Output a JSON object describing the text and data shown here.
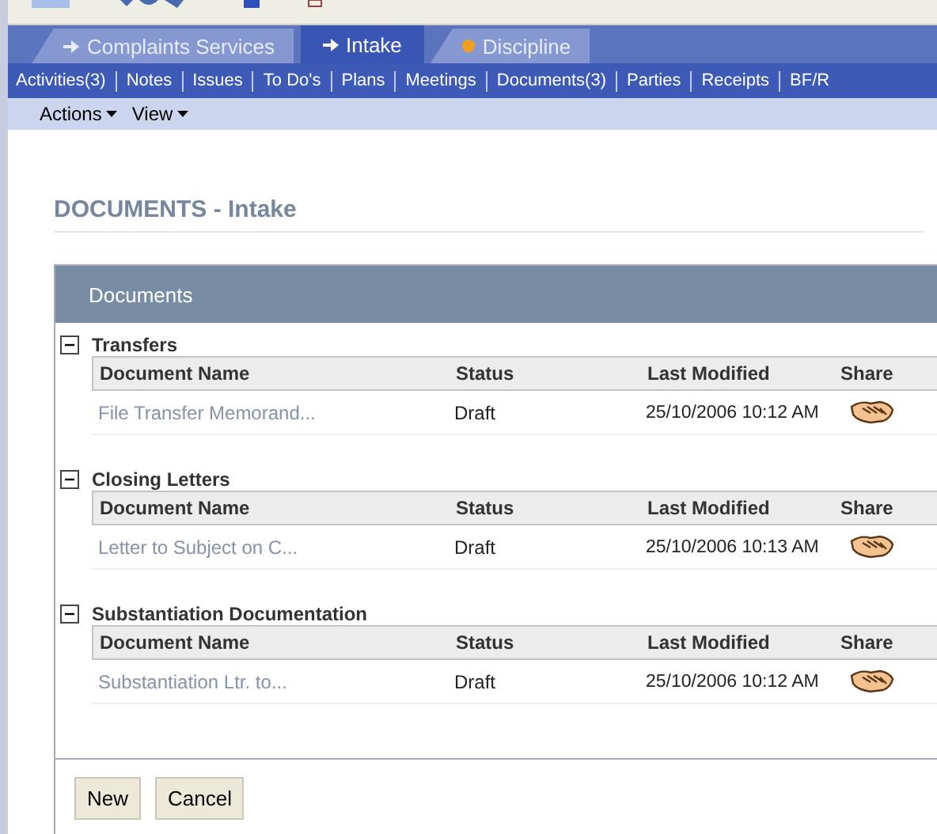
{
  "tabs": [
    {
      "label": "Complaints Services",
      "kind": "arrow",
      "selected": false
    },
    {
      "label": "Intake",
      "kind": "arrow",
      "selected": true
    },
    {
      "label": "Discipline",
      "kind": "dot",
      "selected": false
    }
  ],
  "subnav": [
    "Activities(3)",
    "Notes",
    "Issues",
    "To Do's",
    "Plans",
    "Meetings",
    "Documents(3)",
    "Parties",
    "Receipts",
    "BF/R"
  ],
  "menus": [
    "Actions",
    "View"
  ],
  "page_title": "DOCUMENTS - Intake",
  "panel": {
    "title": "Documents",
    "groups": [
      {
        "title": "Transfers",
        "expanded": true,
        "columns": [
          "Document Name",
          "Status",
          "Last Modified",
          "Share"
        ],
        "rows": [
          {
            "name": "File Transfer Memorand...",
            "status": "Draft",
            "modified": "25/10/2006 10:12 AM"
          }
        ]
      },
      {
        "title": "Closing Letters",
        "expanded": true,
        "columns": [
          "Document Name",
          "Status",
          "Last Modified",
          "Share"
        ],
        "rows": [
          {
            "name": "Letter to Subject on C...",
            "status": "Draft",
            "modified": "25/10/2006 10:13 AM"
          }
        ]
      },
      {
        "title": "Substantiation Documentation",
        "expanded": true,
        "columns": [
          "Document Name",
          "Status",
          "Last Modified",
          "Share"
        ],
        "rows": [
          {
            "name": "Substantiation Ltr. to...",
            "status": "Draft",
            "modified": "25/10/2006 10:12 AM"
          }
        ]
      }
    ]
  },
  "buttons": [
    "New",
    "Cancel"
  ]
}
